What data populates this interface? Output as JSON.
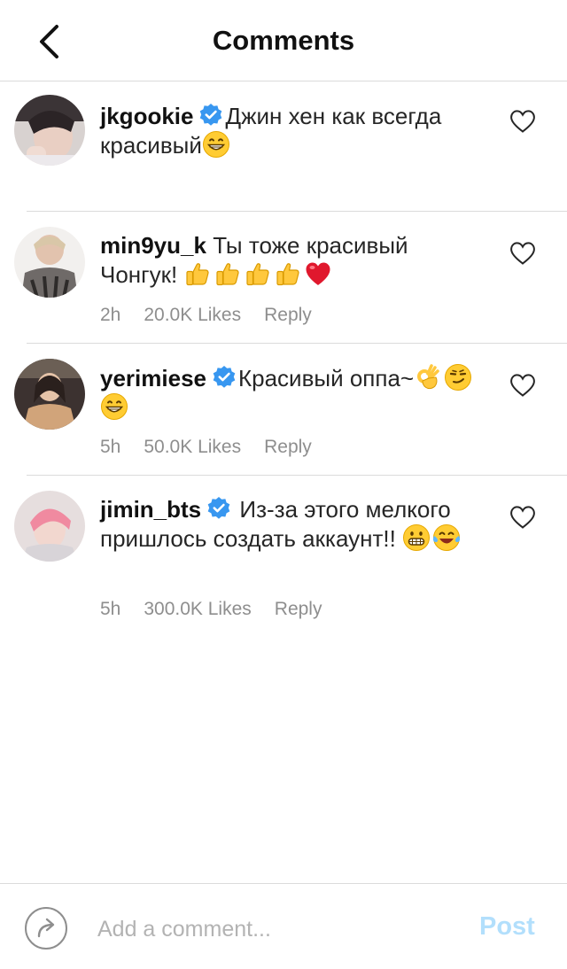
{
  "header": {
    "title": "Comments"
  },
  "comments": [
    {
      "username": "jkgookie",
      "verified": true,
      "text": "Джин хен как всегда красивый",
      "emoji": [
        "grin-emoji"
      ]
    },
    {
      "username": "min9yu_k",
      "verified": false,
      "text": "Ты тоже красивый Чонгук!",
      "emoji": [
        "thumbs-up-emoji",
        "thumbs-up-emoji",
        "thumbs-up-emoji",
        "thumbs-up-emoji",
        "red-heart-emoji"
      ],
      "time": "2h",
      "likes": "20.0K Likes",
      "reply": "Reply"
    },
    {
      "username": "yerimiese",
      "verified": true,
      "text": "Красивый оппа~",
      "emoji": [
        "ok-hand-emoji",
        "smirk-emoji",
        "grin-emoji"
      ],
      "time": "5h",
      "likes": "50.0K Likes",
      "reply": "Reply"
    },
    {
      "username": "jimin_bts",
      "verified": true,
      "text": "Из-за этого мелкого пришлось создать аккаунт!!",
      "emoji": [
        "grimace-emoji",
        "tears-of-joy-emoji"
      ],
      "time": "5h",
      "likes": "300.0K Likes",
      "reply": "Reply"
    }
  ],
  "footer": {
    "placeholder": "Add a comment...",
    "post_label": "Post"
  },
  "colors": {
    "verified": "#3897f0",
    "post_disabled": "#b2dffc",
    "heart_outline": "#262626",
    "meta_text": "#8e8e8e",
    "divider": "#dbdbdb"
  }
}
